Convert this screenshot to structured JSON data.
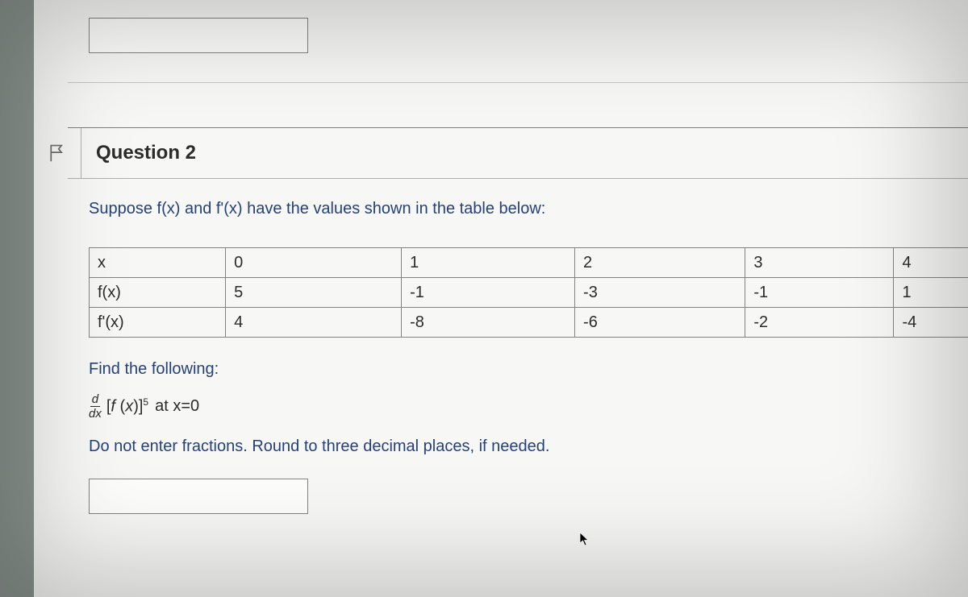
{
  "question": {
    "label": "Question 2",
    "prompt": "Suppose f(x) and f'(x) have the values shown in the table below:",
    "find_label": "Find the following:",
    "expression_at": "at x=0",
    "round_note": "Do not enter fractions. Round to three decimal places, if needed."
  },
  "table": {
    "rows": [
      {
        "head": "x",
        "cells": [
          "0",
          "1",
          "2",
          "3",
          "4"
        ]
      },
      {
        "head": "f(x)",
        "cells": [
          "5",
          "-1",
          "-3",
          "-1",
          "1"
        ]
      },
      {
        "head": "f'(x)",
        "cells": [
          "4",
          "-8",
          "-6",
          "-2",
          "-4"
        ]
      }
    ]
  },
  "inputs": {
    "top_value": "",
    "answer_value": ""
  }
}
